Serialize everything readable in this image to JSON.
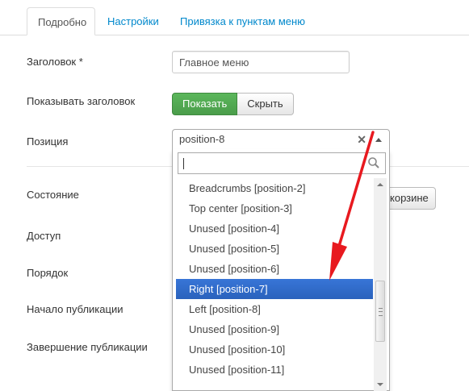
{
  "tabs": [
    {
      "label": "Подробно",
      "active": true
    },
    {
      "label": "Настройки",
      "active": false
    },
    {
      "label": "Привязка к пунктам меню",
      "active": false
    }
  ],
  "form": {
    "title_label": "Заголовок *",
    "title_value": "Главное меню",
    "show_title_label": "Показывать заголовок",
    "show_button": "Показать",
    "hide_button": "Скрыть",
    "position_label": "Позиция",
    "position_value": "position-8",
    "clear_symbol": "✕",
    "status_label": "Состояние",
    "trash_button_partial": "корзине",
    "access_label": "Доступ",
    "ordering_label": "Порядок",
    "publish_up_label": "Начало публикации",
    "publish_down_label": "Завершение публикации"
  },
  "dropdown": {
    "search_value": "",
    "results": [
      "Breadcrumbs [position-2]",
      "Top center [position-3]",
      "Unused [position-4]",
      "Unused [position-5]",
      "Unused [position-6]",
      "Right [position-7]",
      "Left [position-8]",
      "Unused [position-9]",
      "Unused [position-10]",
      "Unused [position-11]"
    ],
    "highlighted": "Right [position-7]"
  },
  "colors": {
    "show_button": "#4a9d4a",
    "highlight": "#3875d7",
    "annotation_arrow": "#e8191f",
    "tab_link": "#0088cc"
  },
  "icons": {
    "search": "search-icon",
    "clear": "close-icon",
    "dropdown_arrow": "chevron-up-icon"
  }
}
